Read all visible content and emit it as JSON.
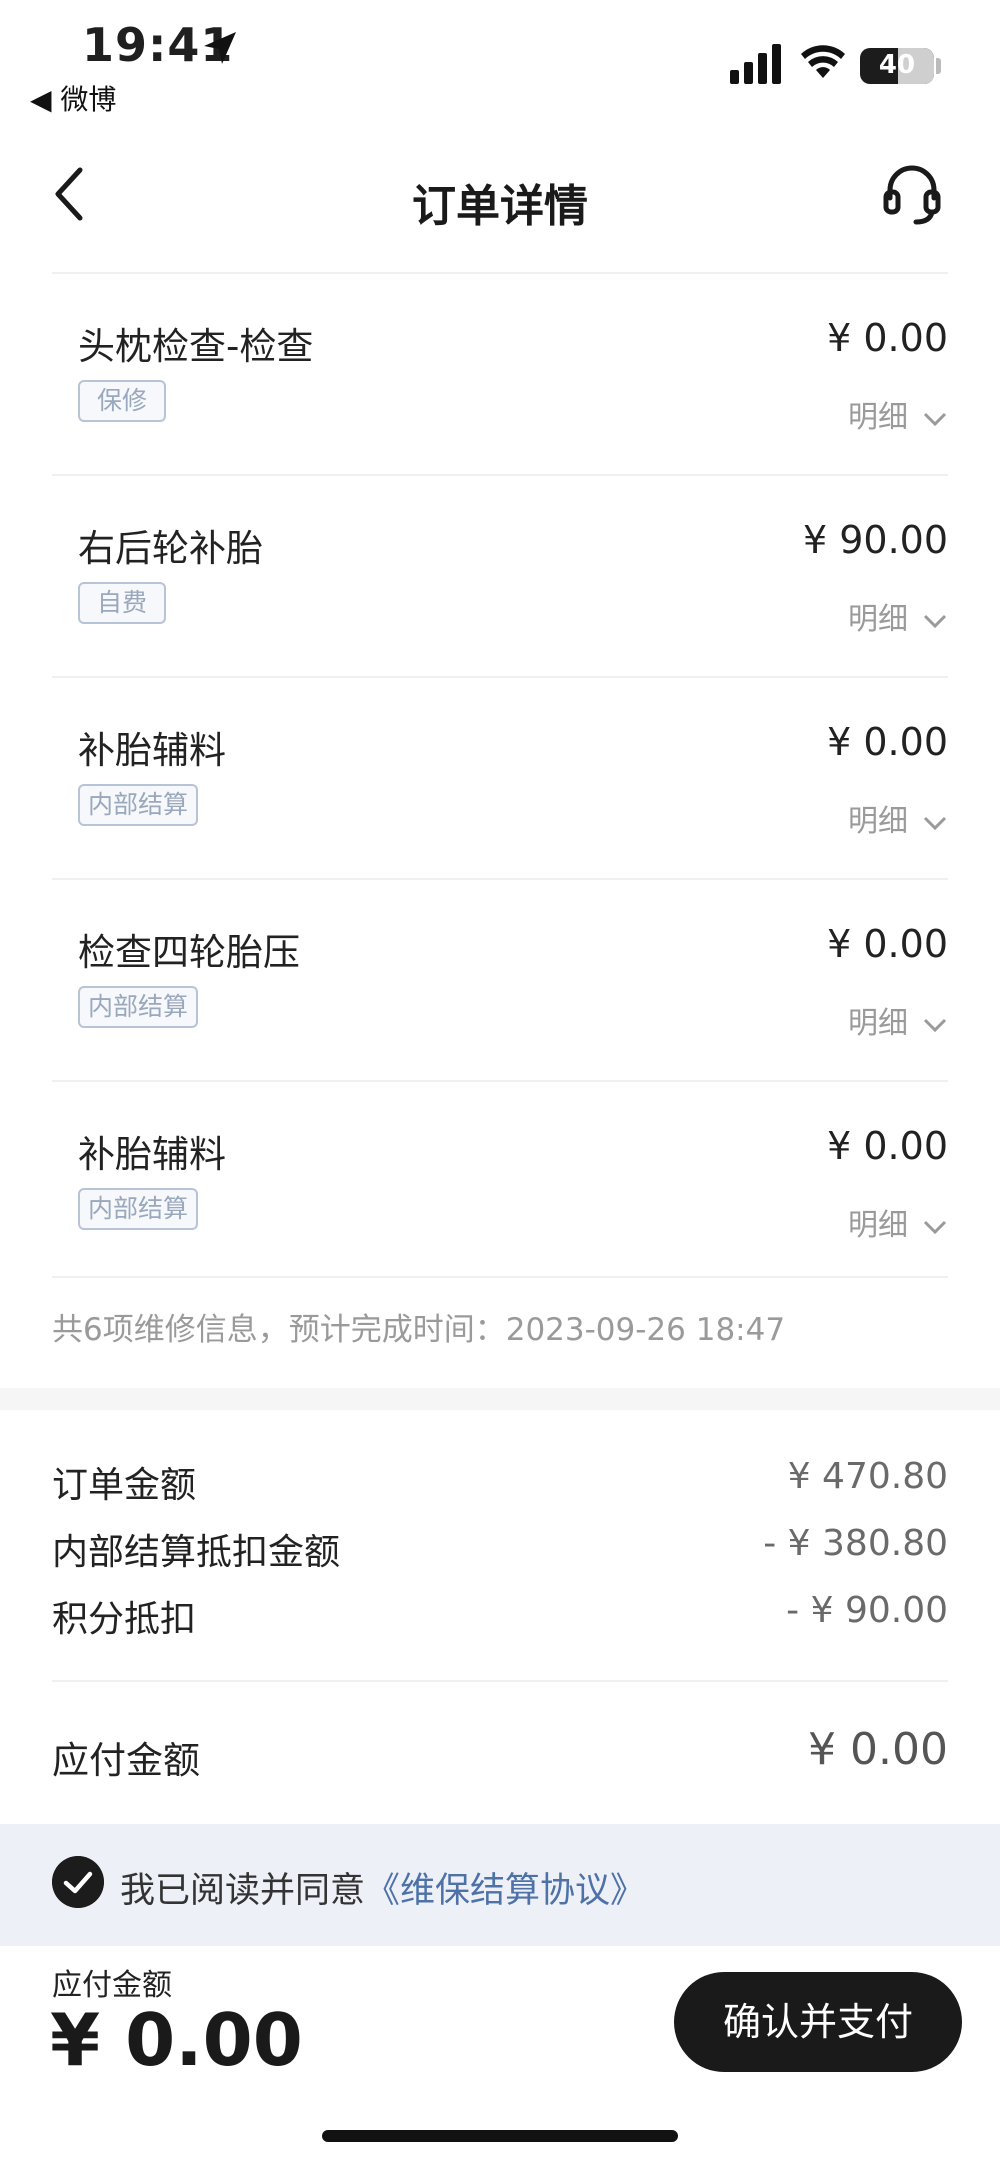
{
  "status_bar": {
    "time": "19:41",
    "back_app": "◀ 微博",
    "battery": "40"
  },
  "nav": {
    "title": "订单详情"
  },
  "items": [
    {
      "name": "头枕检查-检查",
      "price": "¥ 0.00",
      "tag": "保修",
      "detail": "明细"
    },
    {
      "name": "右后轮补胎",
      "price": "¥ 90.00",
      "tag": "自费",
      "detail": "明细"
    },
    {
      "name": "补胎辅料",
      "price": "¥ 0.00",
      "tag": "内部结算",
      "detail": "明细"
    },
    {
      "name": "检查四轮胎压",
      "price": "¥ 0.00",
      "tag": "内部结算",
      "detail": "明细"
    },
    {
      "name": "补胎辅料",
      "price": "¥ 0.00",
      "tag": "内部结算",
      "detail": "明细"
    }
  ],
  "summary": "共6项维修信息，预计完成时间：2023-09-26 18:47",
  "amounts": {
    "order_label": "订单金额",
    "order_value": "¥ 470.80",
    "internal_label": "内部结算抵扣金额",
    "internal_value": "- ¥ 380.80",
    "points_label": "积分抵扣",
    "points_value": "- ¥ 90.00",
    "payable_label": "应付金额",
    "payable_value": "¥ 0.00"
  },
  "agreement": {
    "prefix": "我已阅读并同意",
    "link": "《维保结算协议》",
    "checked": true
  },
  "footer": {
    "label": "应付金额",
    "total": "¥ 0.00",
    "pay_button": "确认并支付"
  },
  "colors": {
    "accent_link": "#4e72a8",
    "button_bg": "#1a1a1a",
    "tag_border": "#b7c3d6"
  }
}
